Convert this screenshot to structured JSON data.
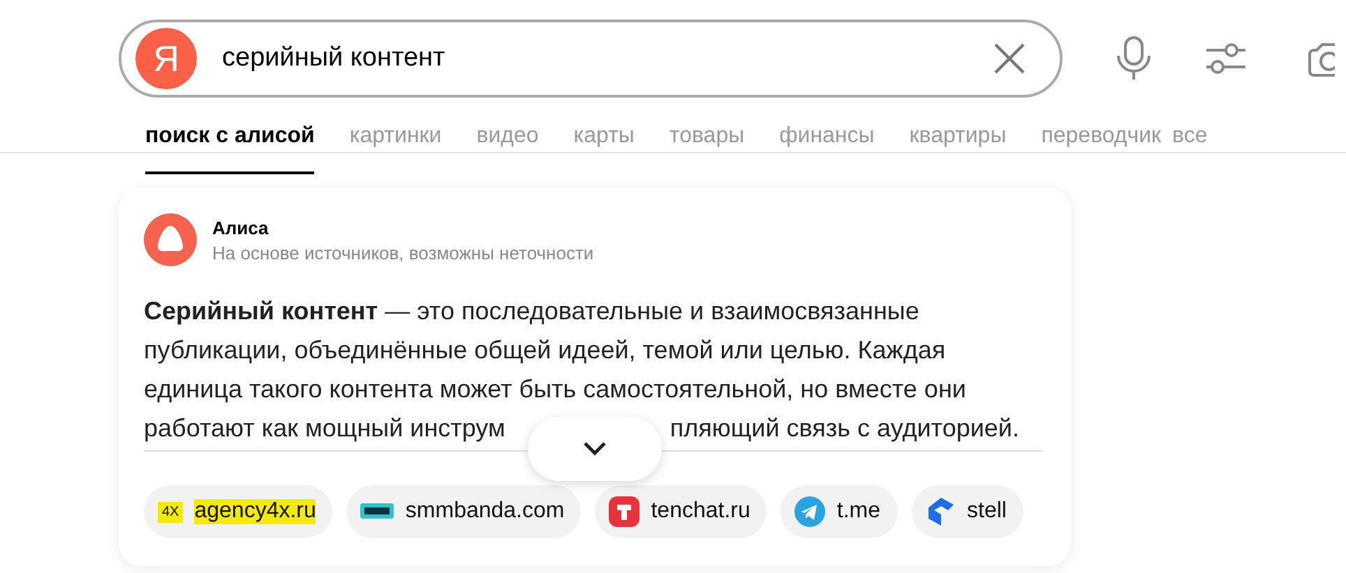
{
  "search": {
    "logo": "Я",
    "value": "серийный контент"
  },
  "tabs": [
    {
      "label": "поиск с алисой",
      "selected": true
    },
    {
      "label": "картинки",
      "selected": false
    },
    {
      "label": "видео",
      "selected": false
    },
    {
      "label": "карты",
      "selected": false
    },
    {
      "label": "товары",
      "selected": false
    },
    {
      "label": "финансы",
      "selected": false
    },
    {
      "label": "квартиры",
      "selected": false
    },
    {
      "label": "переводчик",
      "selected": false
    },
    {
      "label": "все",
      "selected": false
    }
  ],
  "answer": {
    "author": "Алиса",
    "note": "На основе источников, возможны неточности",
    "lines": [
      "**Серийный контент** — это последовательные и взаимосвязанные",
      "публикации, объединённые общей идеей, темой или целью. Каждая",
      "единица такого контента может быть самостоятельной, но вместе они"
    ],
    "cut_line_start": "работают как мощный инструм",
    "cut_line_end": "пляющий связь с аудиторией.",
    "sources": [
      {
        "kind": "fourx",
        "logo_text": "4X",
        "label": "agency4x.ru",
        "highlighted": true
      },
      {
        "kind": "smm",
        "label": "smmbanda.com",
        "highlighted": false
      },
      {
        "kind": "tenchat",
        "label": "tenchat.ru",
        "highlighted": false
      },
      {
        "kind": "telegram",
        "label": "t.me",
        "highlighted": false
      },
      {
        "kind": "stell",
        "label": "stell",
        "highlighted": false
      }
    ]
  }
}
